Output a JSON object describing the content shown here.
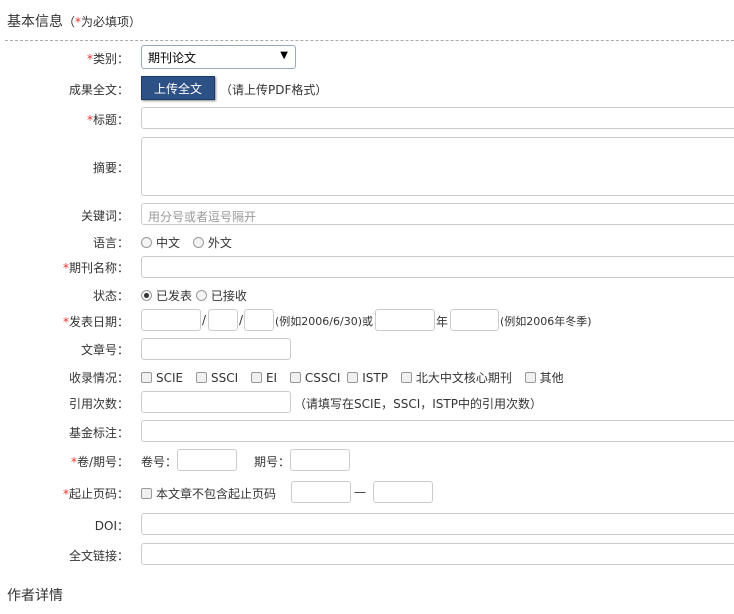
{
  "section": {
    "title": "基本信息",
    "note_prefix": "（",
    "note_star": "*",
    "note": "为必填项）"
  },
  "fields": {
    "category": {
      "label": "类别：",
      "value": "期刊论文"
    },
    "fulltext": {
      "label": "成果全文：",
      "button": "上传全文",
      "hint": "（请上传PDF格式）"
    },
    "title": {
      "label": "标题："
    },
    "abstract": {
      "label": "摘要："
    },
    "keywords": {
      "label": "关键词：",
      "placeholder": "用分号或者逗号隔开"
    },
    "language": {
      "label": "语言：",
      "options": [
        "中文",
        "外文"
      ]
    },
    "journal": {
      "label": "期刊名称："
    },
    "status": {
      "label": "状态：",
      "options": [
        "已发表",
        "已接收"
      ]
    },
    "pubdate": {
      "label": "发表日期：",
      "sep": "/",
      "hint1": "(例如2006/6/30)或",
      "year": "年",
      "hint2": "(例如2006年冬季)"
    },
    "article_no": {
      "label": "文章号："
    },
    "indexed": {
      "label": "收录情况：",
      "options": [
        "SCIE",
        "SSCI",
        "EI",
        "CSSCI",
        "ISTP",
        "北大中文核心期刊",
        "其他"
      ]
    },
    "citations": {
      "label": "引用次数：",
      "hint": "（请填写在SCIE，SSCI，ISTP中的引用次数）"
    },
    "fund": {
      "label": "基金标注："
    },
    "volume": {
      "label": "卷/期号：",
      "vol": "卷号：",
      "issue": "期号："
    },
    "pages": {
      "label": "起止页码：",
      "no_pages": "本文章不包含起止页码",
      "dash": "—"
    },
    "doi": {
      "label": "DOI："
    },
    "link": {
      "label": "全文链接："
    }
  },
  "footer": {
    "title": "作者详情"
  },
  "required_star": "*"
}
